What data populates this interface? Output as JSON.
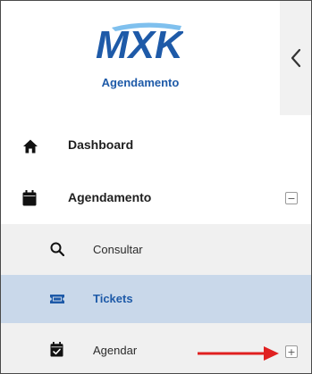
{
  "brand": {
    "logo_text": "MXK",
    "title": "Agendamento"
  },
  "menu": {
    "dashboard": {
      "label": "Dashboard",
      "icon": "home-icon"
    },
    "agendamento": {
      "label": "Agendamento",
      "icon": "calendar-icon",
      "toggle": "−",
      "expanded": true
    },
    "submenu": [
      {
        "label": "Consultar",
        "icon": "search-icon",
        "active": false
      },
      {
        "label": "Tickets",
        "icon": "ticket-icon",
        "active": true
      },
      {
        "label": "Agendar",
        "icon": "calendar-check-icon",
        "active": false,
        "toggle": "+"
      }
    ]
  },
  "colors": {
    "brand_blue": "#1e5aa8",
    "active_bg": "#c9d8ea",
    "submenu_bg": "#f0f0f0",
    "arrow_red": "#e02020"
  }
}
